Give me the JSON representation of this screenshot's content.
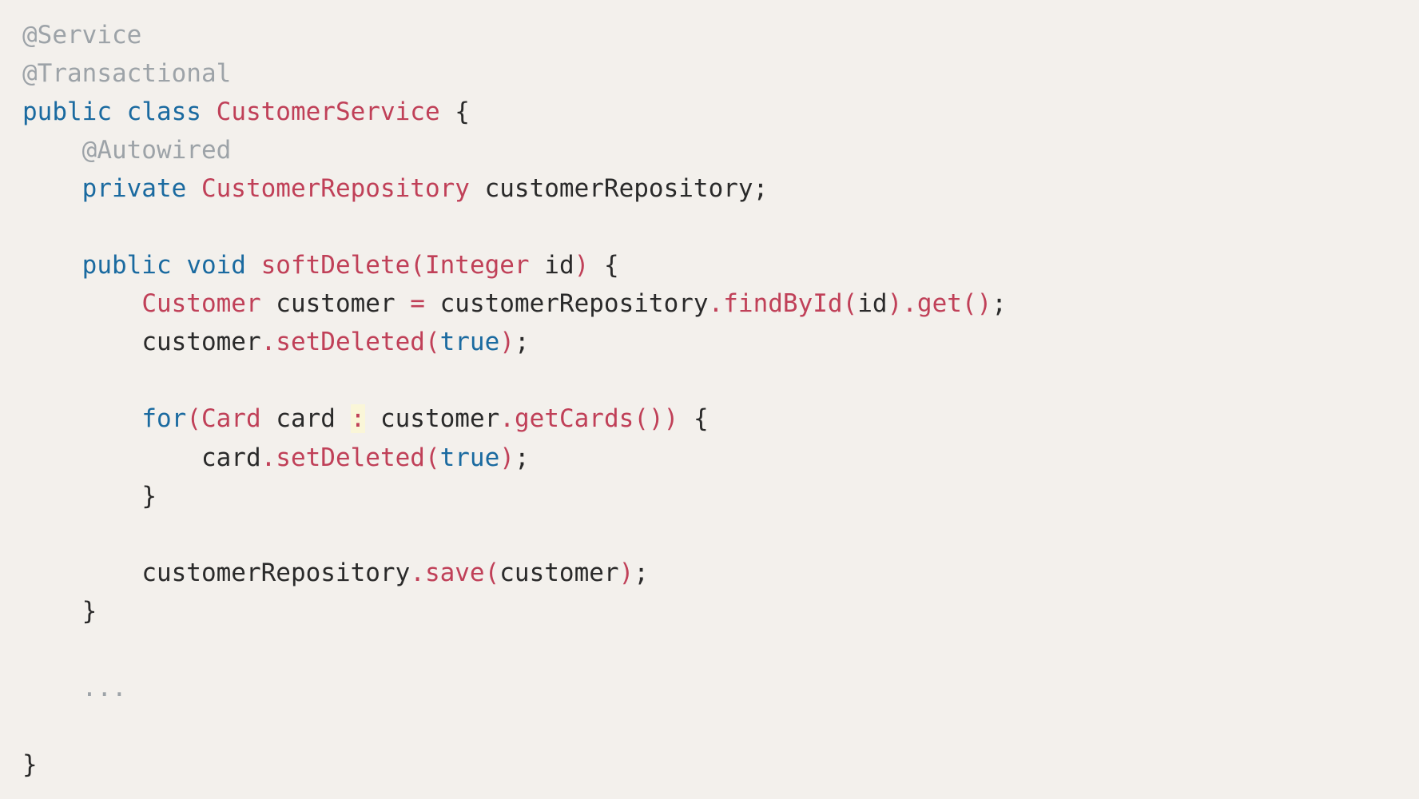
{
  "code": {
    "l1": {
      "ann1": "@Service"
    },
    "l2": {
      "ann1": "@Transactional"
    },
    "l3": {
      "kw1": "public",
      "kw2": "class",
      "typ": "CustomerService",
      "brace": "{"
    },
    "l4": {
      "ann": "@Autowired"
    },
    "l5": {
      "kw": "private",
      "typ": "CustomerRepository",
      "name": "customerRepository",
      "semi": ";"
    },
    "l6": {
      "kw1": "public",
      "kw2": "void",
      "fn": "softDelete",
      "lp": "(",
      "typ": "Integer",
      "arg": "id",
      "rp": ")",
      "brace": "{"
    },
    "l7": {
      "typ": "Customer",
      "var": "customer",
      "eq": "=",
      "obj": "customerRepository",
      "dot1": ".",
      "fn1": "findById",
      "lp1": "(",
      "arg": "id",
      "rp1": ")",
      "dot2": ".",
      "fn2": "get",
      "lp2": "(",
      "rp2": ")",
      "semi": ";"
    },
    "l8": {
      "obj": "customer",
      "dot": ".",
      "fn": "setDeleted",
      "lp": "(",
      "arg": "true",
      "rp": ")",
      "semi": ";"
    },
    "l9": {
      "kw": "for",
      "lp": "(",
      "typ": "Card",
      "var": "card",
      "colon": ":",
      "obj": "customer",
      "dot": ".",
      "fn": "getCards",
      "lp2": "(",
      "rp2": ")",
      "rp": ")",
      "brace": "{"
    },
    "l10": {
      "obj": "card",
      "dot": ".",
      "fn": "setDeleted",
      "lp": "(",
      "arg": "true",
      "rp": ")",
      "semi": ";"
    },
    "l11": {
      "brace": "}"
    },
    "l12": {
      "obj": "customerRepository",
      "dot": ".",
      "fn": "save",
      "lp": "(",
      "arg": "customer",
      "rp": ")",
      "semi": ";"
    },
    "l13": {
      "brace": "}"
    },
    "l14": {
      "ellipsis": "..."
    },
    "l15": {
      "brace": "}"
    }
  }
}
